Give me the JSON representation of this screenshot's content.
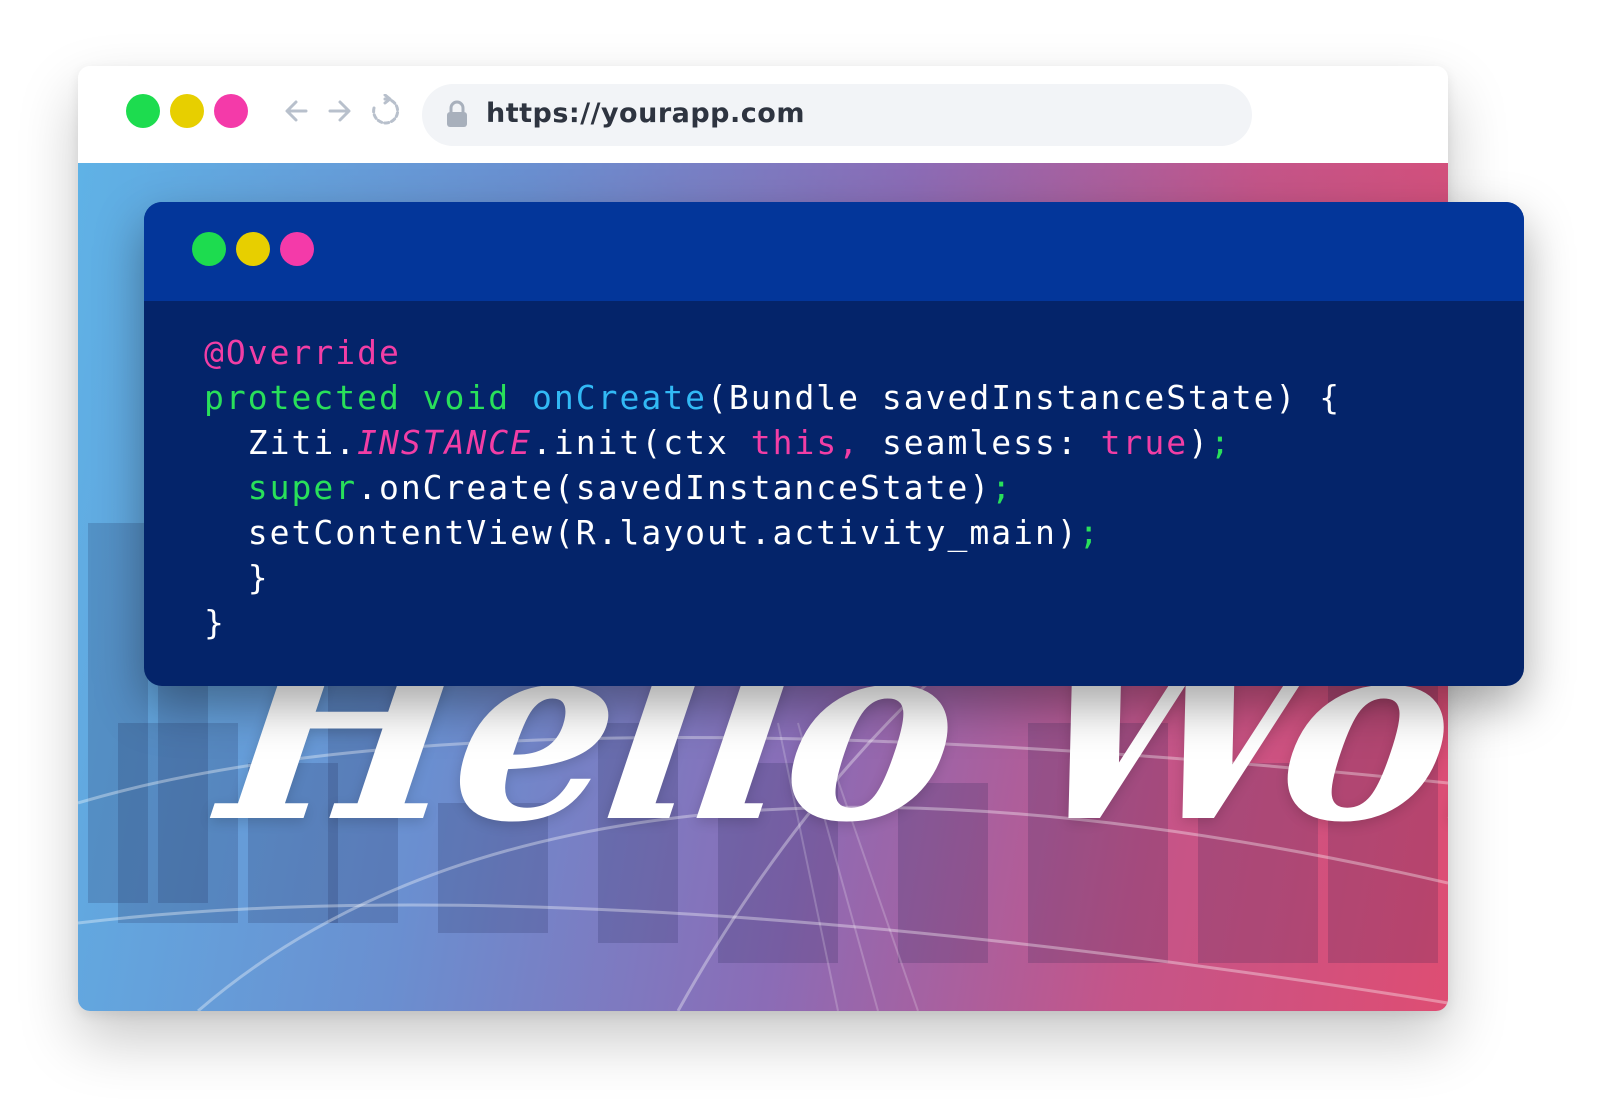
{
  "window_controls": {
    "close_color": "#1ddc4f",
    "minimize_color": "#e7cf00",
    "zoom_color": "#f43aa9"
  },
  "nav": {
    "back_icon": "arrow-left-icon",
    "forward_icon": "arrow-right-icon",
    "reload_icon": "reload-icon"
  },
  "address_bar": {
    "lock_icon": "lock-icon",
    "url": "https://yourapp.com"
  },
  "hero": {
    "text": "Hello World",
    "gradient": [
      "#5fb2e6",
      "#8b6cb6",
      "#de4d73"
    ]
  },
  "code_window": {
    "header_color": "#03369a",
    "body_color": "#04246a",
    "lines": [
      [
        {
          "t": "@Override",
          "c": "ann"
        }
      ],
      [
        {
          "t": "protected void ",
          "c": "kw"
        },
        {
          "t": "onCreate",
          "c": "fn"
        },
        {
          "t": "(Bundle savedInstanceState) {",
          "c": "pl"
        }
      ],
      [
        {
          "t": "  Ziti.",
          "c": "pl"
        },
        {
          "t": "INSTANCE",
          "c": "it"
        },
        {
          "t": ".init(ctx ",
          "c": "pl"
        },
        {
          "t": "this, ",
          "c": "kw2"
        },
        {
          "t": "seamless: ",
          "c": "pl"
        },
        {
          "t": "true",
          "c": "kw2"
        },
        {
          "t": ")",
          "c": "pl"
        },
        {
          "t": ";",
          "c": "semi"
        }
      ],
      [
        {
          "t": "  super",
          "c": "kw"
        },
        {
          "t": ".onCreate(savedInstanceState)",
          "c": "pl"
        },
        {
          "t": ";",
          "c": "semi"
        }
      ],
      [
        {
          "t": "  setContentView(R.layout.activity_main)",
          "c": "pl"
        },
        {
          "t": ";",
          "c": "semi"
        }
      ],
      [
        {
          "t": "  }",
          "c": "pl"
        }
      ],
      [
        {
          "t": "}",
          "c": "pl"
        }
      ]
    ]
  }
}
